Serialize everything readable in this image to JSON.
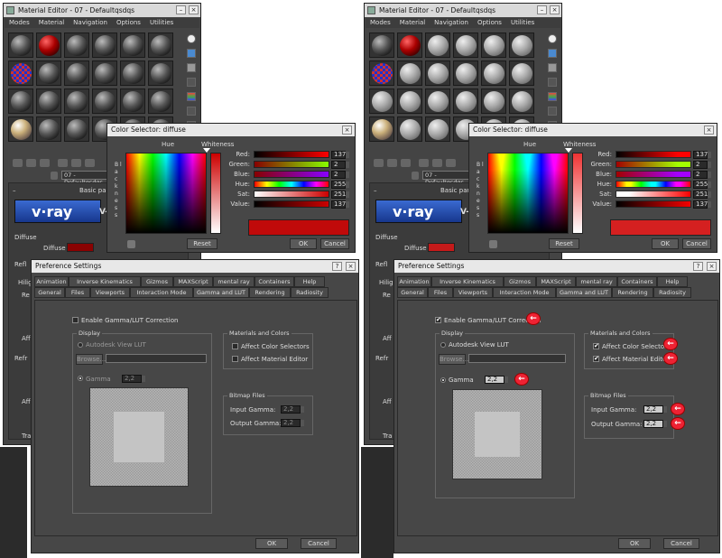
{
  "material_editor": {
    "title": "Material Editor - 07 - Defaultqsdqs",
    "menu": [
      "Modes",
      "Material",
      "Navigation",
      "Options",
      "Utilities"
    ],
    "material_name": "07 - Defaultqsdqs",
    "rollout_title": "Basic parameters",
    "vray_logo": "v·ray",
    "diffuse_section": "Diffuse",
    "diffuse_label": "Diffuse",
    "refl_short": "Refl",
    "hilig": "Hilig",
    "re": "Re",
    "aff": "Aff",
    "refr": "Refr",
    "tra": "Tra",
    "right_x_label": "V-",
    "button_close": "×",
    "button_min": "–"
  },
  "color_selector": {
    "title": "Color Selector: diffuse",
    "hue_label": "Hue",
    "whiteness_label": "Whiteness",
    "blackness_label": "B l a c k n e s s",
    "rows": [
      {
        "label": "Red:",
        "value": "137"
      },
      {
        "label": "Green:",
        "value": "2"
      },
      {
        "label": "Blue:",
        "value": "2"
      },
      {
        "label": "Hue:",
        "value": "255"
      },
      {
        "label": "Sat:",
        "value": "251"
      },
      {
        "label": "Value:",
        "value": "137"
      }
    ],
    "reset": "Reset",
    "ok": "OK",
    "cancel": "Cancel",
    "color": "#890202"
  },
  "prefs": {
    "title": "Preference Settings",
    "help_btn": "?",
    "tabs_top": [
      "Animation",
      "Inverse Kinematics",
      "Gizmos",
      "MAXScript",
      "mental ray",
      "Containers",
      "Help"
    ],
    "tabs_bottom": [
      "General",
      "Files",
      "Viewports",
      "Interaction Mode",
      "Gamma and LUT",
      "Rendering",
      "Radiosity"
    ],
    "enable_label": "Enable Gamma/LUT Correction",
    "display_group": "Display",
    "autodesk_lut": "Autodesk View LUT",
    "browse": "Browse...",
    "gamma_label": "Gamma",
    "gamma_value": "2,2",
    "materials_group": "Materials and Colors",
    "affect_color": "Affect Color Selectors",
    "affect_material": "Affect Material Editor",
    "bitmap_group": "Bitmap Files",
    "input_gamma": "Input Gamma:",
    "output_gamma": "Output Gamma:",
    "input_value": "2,2",
    "output_value": "2,2",
    "ok": "OK",
    "cancel": "Cancel"
  },
  "colors": {
    "accent_red": "#e23"
  }
}
